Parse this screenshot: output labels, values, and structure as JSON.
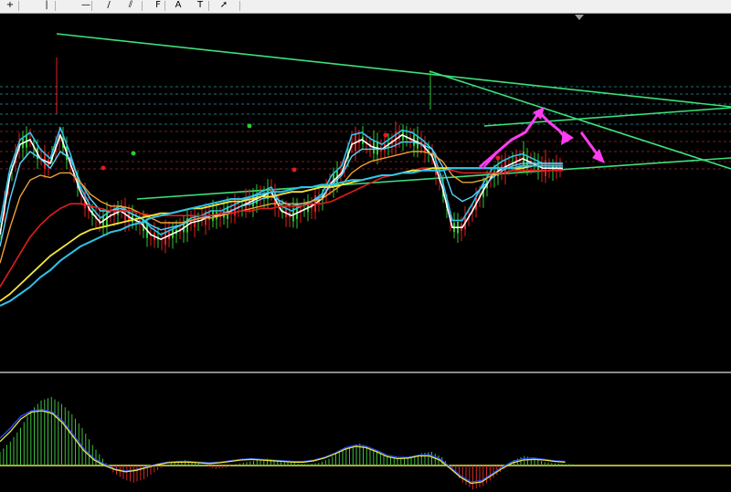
{
  "toolbar": {
    "buttons": [
      {
        "name": "crosshair-tool-button",
        "glyph": "+",
        "icon": "crosshair-icon"
      },
      {
        "name": "vertical-line-tool-button",
        "glyph": "|",
        "icon": "vertical-line-icon"
      },
      {
        "name": "horizontal-line-tool-button",
        "glyph": "—",
        "icon": "horizontal-line-icon"
      },
      {
        "name": "trendline-tool-button",
        "glyph": "/",
        "icon": "trendline-icon"
      },
      {
        "name": "equidistant-channel-tool-button",
        "glyph": "⫽",
        "icon": "channel-icon"
      },
      {
        "name": "fibonacci-tool-button",
        "glyph": "F",
        "icon": "fibonacci-icon"
      },
      {
        "name": "text-tool-button",
        "glyph": "A",
        "icon": "text-icon"
      },
      {
        "name": "text-label-tool-button",
        "glyph": "T",
        "icon": "text-label-icon"
      },
      {
        "name": "arrow-tool-button",
        "glyph": "➚",
        "icon": "arrow-menu-icon"
      }
    ]
  },
  "colors": {
    "background": "#000000",
    "grid_dash_cyan": "#1e6f77",
    "grid_dash_red": "#7a1e1e",
    "trendline_green": "#3de07a",
    "ma_white": "#ffffff",
    "ma_cyan": "#2fc3ea",
    "ma_blue": "#1e7fd8",
    "ma_yellow": "#f5e63a",
    "ma_orange": "#f0a030",
    "ma_red": "#e01e1e",
    "ma_lightblue": "#56d3ff",
    "forecast_magenta": "#ff3df0",
    "macd_green": "#3fbf3f",
    "macd_red": "#d02a2a",
    "signal_yellow": "#f0e040",
    "signal_blue": "#2050ff",
    "zero_line": "#e8e84a"
  },
  "chart_data": [
    {
      "type": "line",
      "series": [
        {
          "values": [
            0.3,
            0.55,
            0.68,
            0.7,
            0.62,
            0.6,
            0.72,
            0.6,
            0.48,
            0.4,
            0.35,
            0.38,
            0.4,
            0.37,
            0.35,
            0.3,
            0.28,
            0.3,
            0.32,
            0.35,
            0.36,
            0.38,
            0.38,
            0.4,
            0.42,
            0.44,
            0.46,
            0.48,
            0.4,
            0.38,
            0.4,
            0.42,
            0.45,
            0.52,
            0.56,
            0.68,
            0.7,
            0.67,
            0.66,
            0.69,
            0.72,
            0.7,
            0.68,
            0.63,
            0.5,
            0.33,
            0.33,
            0.4,
            0.48,
            0.55,
            0.58,
            0.6,
            0.62,
            0.6,
            0.58,
            0.58,
            0.58
          ]
        },
        {
          "values": [
            0.35,
            0.58,
            0.7,
            0.73,
            0.66,
            0.62,
            0.75,
            0.64,
            0.5,
            0.42,
            0.37,
            0.4,
            0.42,
            0.39,
            0.37,
            0.33,
            0.3,
            0.32,
            0.34,
            0.37,
            0.38,
            0.4,
            0.4,
            0.42,
            0.44,
            0.46,
            0.48,
            0.5,
            0.42,
            0.4,
            0.42,
            0.44,
            0.47,
            0.55,
            0.59,
            0.72,
            0.73,
            0.7,
            0.68,
            0.71,
            0.74,
            0.73,
            0.7,
            0.66,
            0.53,
            0.36,
            0.36,
            0.43,
            0.51,
            0.58,
            0.61,
            0.63,
            0.64,
            0.62,
            0.6,
            0.6,
            0.6
          ]
        },
        {
          "values": [
            0.25,
            0.45,
            0.6,
            0.65,
            0.62,
            0.58,
            0.65,
            0.62,
            0.52,
            0.45,
            0.4,
            0.4,
            0.41,
            0.39,
            0.37,
            0.34,
            0.32,
            0.33,
            0.34,
            0.36,
            0.37,
            0.38,
            0.39,
            0.4,
            0.42,
            0.43,
            0.45,
            0.46,
            0.44,
            0.42,
            0.43,
            0.44,
            0.46,
            0.51,
            0.55,
            0.63,
            0.66,
            0.66,
            0.66,
            0.67,
            0.69,
            0.69,
            0.68,
            0.66,
            0.59,
            0.47,
            0.44,
            0.46,
            0.5,
            0.54,
            0.57,
            0.59,
            0.6,
            0.6,
            0.6,
            0.6,
            0.6
          ]
        },
        {
          "values": [
            0.18,
            0.33,
            0.46,
            0.53,
            0.55,
            0.54,
            0.56,
            0.56,
            0.52,
            0.47,
            0.44,
            0.42,
            0.42,
            0.41,
            0.39,
            0.37,
            0.35,
            0.35,
            0.35,
            0.36,
            0.37,
            0.37,
            0.38,
            0.39,
            0.4,
            0.41,
            0.42,
            0.43,
            0.43,
            0.43,
            0.43,
            0.44,
            0.45,
            0.48,
            0.51,
            0.56,
            0.59,
            0.61,
            0.62,
            0.63,
            0.64,
            0.65,
            0.65,
            0.64,
            0.61,
            0.55,
            0.52,
            0.52,
            0.53,
            0.55,
            0.56,
            0.57,
            0.58,
            0.59,
            0.59,
            0.59,
            0.59
          ]
        },
        {
          "values": [
            0.08,
            0.15,
            0.22,
            0.29,
            0.34,
            0.38,
            0.41,
            0.43,
            0.43,
            0.42,
            0.41,
            0.4,
            0.4,
            0.4,
            0.39,
            0.38,
            0.38,
            0.38,
            0.38,
            0.38,
            0.38,
            0.38,
            0.39,
            0.39,
            0.4,
            0.4,
            0.41,
            0.41,
            0.42,
            0.42,
            0.42,
            0.43,
            0.43,
            0.44,
            0.46,
            0.48,
            0.5,
            0.52,
            0.54,
            0.55,
            0.56,
            0.57,
            0.58,
            0.58,
            0.58,
            0.57,
            0.56,
            0.56,
            0.56,
            0.56,
            0.56,
            0.57,
            0.57,
            0.57,
            0.57,
            0.57,
            0.57
          ]
        },
        {
          "values": [
            0.02,
            0.05,
            0.09,
            0.13,
            0.17,
            0.21,
            0.24,
            0.27,
            0.3,
            0.32,
            0.33,
            0.34,
            0.35,
            0.36,
            0.37,
            0.38,
            0.39,
            0.39,
            0.4,
            0.41,
            0.41,
            0.42,
            0.43,
            0.44,
            0.44,
            0.45,
            0.46,
            0.46,
            0.47,
            0.48,
            0.48,
            0.49,
            0.5,
            0.5,
            0.51,
            0.52,
            0.53,
            0.54,
            0.55,
            0.55,
            0.56,
            0.57,
            0.57,
            0.58,
            0.58,
            0.58,
            0.58,
            0.58,
            0.58,
            0.58,
            0.58,
            0.58,
            0.58,
            0.59,
            0.59,
            0.59,
            0.59
          ]
        },
        {
          "values": [
            0.0,
            0.02,
            0.05,
            0.08,
            0.12,
            0.15,
            0.19,
            0.22,
            0.25,
            0.27,
            0.29,
            0.31,
            0.32,
            0.34,
            0.35,
            0.37,
            0.38,
            0.39,
            0.4,
            0.41,
            0.42,
            0.43,
            0.44,
            0.45,
            0.45,
            0.46,
            0.47,
            0.48,
            0.48,
            0.49,
            0.5,
            0.5,
            0.51,
            0.51,
            0.52,
            0.53,
            0.53,
            0.54,
            0.55,
            0.55,
            0.56,
            0.56,
            0.57,
            0.57,
            0.57,
            0.58,
            0.58,
            0.58,
            0.58,
            0.58,
            0.58,
            0.58,
            0.59,
            0.59,
            0.59,
            0.59,
            0.59
          ]
        }
      ]
    },
    {
      "type": "bar",
      "values": [
        0.2,
        0.35,
        0.55,
        0.8,
        0.95,
        1.0,
        0.9,
        0.75,
        0.55,
        0.3,
        0.1,
        -0.1,
        -0.2,
        -0.25,
        -0.2,
        -0.1,
        0.0,
        0.05,
        0.08,
        0.05,
        0.0,
        -0.05,
        -0.03,
        0.02,
        0.05,
        0.08,
        0.1,
        0.08,
        0.05,
        0.03,
        0.02,
        0.04,
        0.1,
        0.2,
        0.28,
        0.32,
        0.26,
        0.18,
        0.12,
        0.1,
        0.12,
        0.18,
        0.2,
        0.12,
        -0.05,
        -0.25,
        -0.35,
        -0.3,
        -0.18,
        -0.05,
        0.08,
        0.14,
        0.1,
        0.05,
        0.03,
        0.02
      ],
      "series": [
        {
          "values": [
            0.4,
            0.55,
            0.72,
            0.8,
            0.82,
            0.78,
            0.65,
            0.45,
            0.25,
            0.1,
            0.02,
            -0.05,
            -0.08,
            -0.06,
            -0.02,
            0.02,
            0.05,
            0.06,
            0.06,
            0.05,
            0.04,
            0.05,
            0.07,
            0.09,
            0.1,
            0.09,
            0.08,
            0.07,
            0.06,
            0.06,
            0.08,
            0.12,
            0.18,
            0.26,
            0.3,
            0.28,
            0.22,
            0.15,
            0.12,
            0.12,
            0.15,
            0.16,
            0.1,
            -0.02,
            -0.15,
            -0.24,
            -0.22,
            -0.12,
            -0.02,
            0.06,
            0.1,
            0.11,
            0.09,
            0.07,
            0.06
          ]
        },
        {
          "values": [
            0.35,
            0.5,
            0.68,
            0.78,
            0.8,
            0.76,
            0.62,
            0.42,
            0.22,
            0.08,
            0.0,
            -0.06,
            -0.09,
            -0.07,
            -0.03,
            0.01,
            0.04,
            0.05,
            0.05,
            0.04,
            0.03,
            0.04,
            0.06,
            0.08,
            0.09,
            0.08,
            0.07,
            0.06,
            0.05,
            0.05,
            0.07,
            0.11,
            0.17,
            0.24,
            0.28,
            0.26,
            0.2,
            0.13,
            0.1,
            0.11,
            0.14,
            0.14,
            0.08,
            -0.04,
            -0.17,
            -0.26,
            -0.24,
            -0.14,
            -0.04,
            0.04,
            0.08,
            0.09,
            0.08,
            0.06,
            0.05
          ]
        }
      ]
    }
  ]
}
